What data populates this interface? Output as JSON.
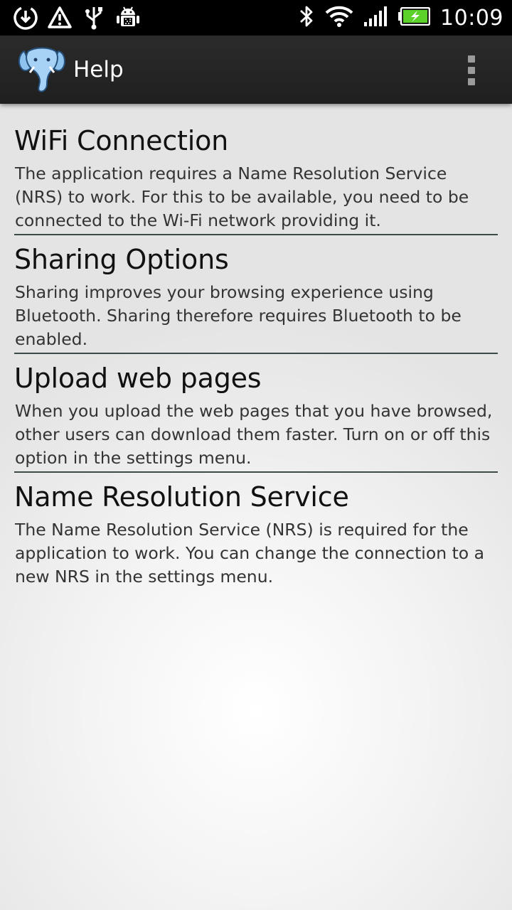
{
  "status_bar": {
    "time": "10:09",
    "icons": [
      "download-icon",
      "warning-icon",
      "usb-icon",
      "android-debug-icon",
      "bluetooth-icon",
      "wifi-icon",
      "signal-icon",
      "battery-charging-icon"
    ],
    "battery_color": "#5cd12a"
  },
  "action_bar": {
    "title": "Help",
    "logo": "elephant-logo",
    "menu_icon": "overflow-menu-icon"
  },
  "sections": [
    {
      "title": "WiFi Connection",
      "body": "The application requires a Name Resolution Service (NRS) to work. For this to be available, you need to be connected to the Wi-Fi network providing it."
    },
    {
      "title": "Sharing Options",
      "body": "Sharing improves your browsing experience using Bluetooth. Sharing therefore requires Bluetooth to be enabled."
    },
    {
      "title": "Upload web pages",
      "body": "When you upload the web pages that you have browsed, other users can download them faster. Turn on or off this option in the settings menu."
    },
    {
      "title": "Name Resolution Service",
      "body": "The Name Resolution Service (NRS) is required for the application to work. You can change the connection to a new NRS in the settings menu."
    }
  ]
}
